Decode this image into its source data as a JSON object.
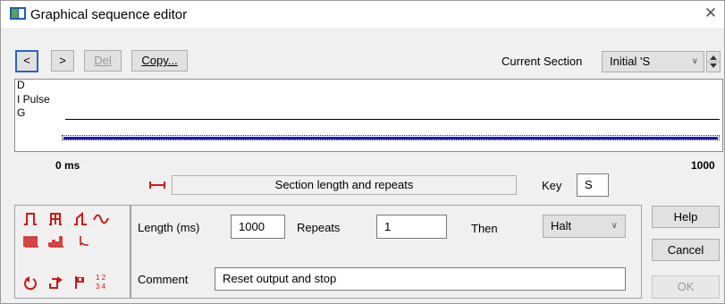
{
  "window": {
    "title": "Graphical sequence editor"
  },
  "toolbar": {
    "prev_label": "<",
    "next_label": ">",
    "del_label": "Del",
    "copy_label": "Copy...",
    "current_section_label": "Current Section",
    "current_section_value": "Initial 'S"
  },
  "canvas": {
    "rows": [
      "D",
      "I Pulse",
      "G"
    ]
  },
  "axis": {
    "start_label": "0 ms",
    "end_label": "1000"
  },
  "section_bar": {
    "label": "Section length and repeats"
  },
  "key": {
    "label": "Key",
    "value": "S"
  },
  "form": {
    "length_label": "Length (ms)",
    "length_value": "1000",
    "repeats_label": "Repeats",
    "repeats_value": "1",
    "then_label": "Then",
    "then_value": "Halt",
    "comment_label": "Comment",
    "comment_value": "Reset output and stop"
  },
  "buttons": {
    "help": "Help",
    "cancel": "Cancel",
    "ok": "OK"
  },
  "colors": {
    "icon_red": "#d01818",
    "trace_blue": "#1a1ab4",
    "focus_blue": "#2b64c6"
  },
  "palette_icons": [
    "pulse-icon",
    "multi-pulse-icon",
    "ramp-icon",
    "sine-icon",
    "pulse-train-icon",
    "varying-pulse-train-icon",
    "step-down-icon",
    "loop-icon",
    "jump-icon",
    "marker-flag-icon",
    "table-icon"
  ]
}
